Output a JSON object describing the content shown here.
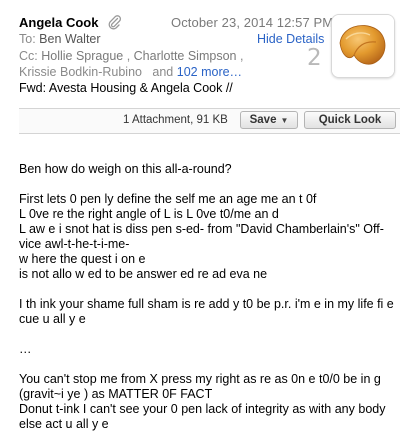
{
  "header": {
    "sender": "Angela Cook",
    "date": "October 23, 2014  12:57 PM",
    "to_label": "To:",
    "to_name": "Ben Walter",
    "hide_details": "Hide Details",
    "cc_label": "Cc:",
    "cc_names": [
      "Hollie Sprague",
      "Charlotte Simpson",
      "Krissie Bodkin-Rubino"
    ],
    "cc_and": "and",
    "cc_more": "102 more…",
    "count": "2",
    "subject": "Fwd: Avesta Housing & Angela Cook //"
  },
  "attachments": {
    "info": "1 Attachment, 91 KB",
    "save_label": "Save",
    "quicklook_label": "Quick Look"
  },
  "body": {
    "p1": "Ben how do weigh on this all-a-round?",
    "p2_lines": [
      "First lets 0 pen ly define the self me an age me an t 0f",
      "L 0ve re the right angle of L is L 0ve t0/me an d",
      "L aw e i snot hat is diss pen s-ed- from \"David Chamberlain's\" Off-",
      "vice awl-t-he-t-i-me-",
      "w here the quest i on e",
      "is not allo w ed to be answer ed re ad eva ne"
    ],
    "p3_lines": [
      "I th ink your shame full sham is re add y t0 be p.r. i'm e in my life fi e",
      "cue u all y e"
    ],
    "p4": "…",
    "p5_lines": [
      "You can't stop me from X press my right as re as 0n e t0/0 be in g",
      "(gravit~i ye ) as MATTER 0F FACT",
      "Donut t-ink I can't see your 0 pen lack of integrity as with any body",
      "else act u all y e"
    ]
  },
  "colors": {
    "link": "#2a63c6",
    "muted": "#8a8a8a",
    "count": "#b9b9b9"
  },
  "icons": [
    "paperclip-icon",
    "fortune-cookie-avatar",
    "dropdown-arrow-icon"
  ]
}
